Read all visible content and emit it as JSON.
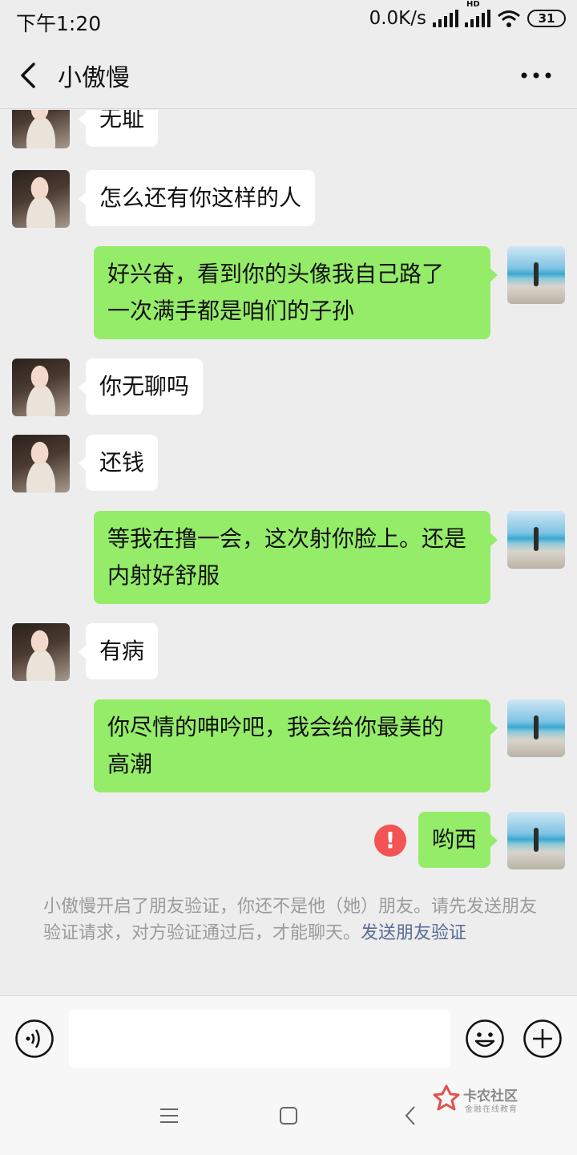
{
  "status_bar": {
    "time": "下午1:20",
    "net_speed": "0.0K/s",
    "hd_label": "HD",
    "battery": "31"
  },
  "header": {
    "title": "小傲慢",
    "back_icon": "chevron-left-icon",
    "more_icon": "more-horizontal-icon"
  },
  "messages": [
    {
      "from": "contact",
      "text": "无耻"
    },
    {
      "from": "contact",
      "text": "怎么还有你这样的人"
    },
    {
      "from": "me",
      "line1": "好兴奋，看到你的头像我自己路了",
      "line2": "一次满手都是咱们的子孙"
    },
    {
      "from": "contact",
      "text": "你无聊吗"
    },
    {
      "from": "contact",
      "text": "还钱"
    },
    {
      "from": "me",
      "line1": "等我在撸一会，这次射你脸上。还是",
      "line2": "内射好舒服"
    },
    {
      "from": "contact",
      "text": "有病"
    },
    {
      "from": "me",
      "line1": "你尽情的呻吟吧，我会给你最美的",
      "line2": "高潮"
    },
    {
      "from": "me",
      "text": "哟西",
      "status": "send-failed",
      "status_mark": "!"
    }
  ],
  "system_notice": {
    "text": "小傲慢开启了朋友验证，你还不是他（她）朋友。请先发送朋友验证请求，对方验证通过后，才能聊天。",
    "link": "发送朋友验证"
  },
  "input_bar": {
    "value": "",
    "voice_icon": "voice-icon",
    "emoji_icon": "emoji-icon",
    "plus_icon": "plus-icon"
  },
  "nav_bar": {
    "menu_icon": "menu-icon",
    "home_icon": "home-icon",
    "back_icon": "back-icon"
  },
  "watermark": {
    "title": "卡农社区",
    "subtitle": "金融在线教育"
  },
  "colors": {
    "outgoing_bubble": "#95ec69",
    "incoming_bubble": "#ffffff",
    "background": "#ededed",
    "link": "#576b95",
    "error": "#f25353"
  }
}
